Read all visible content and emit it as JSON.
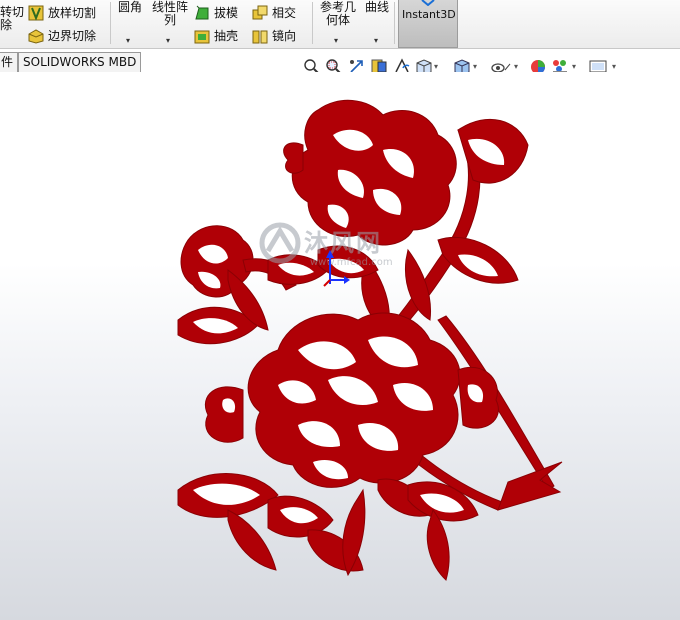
{
  "ribbon": {
    "cmd_revolve_cut_line1": "转切",
    "cmd_revolve_cut_line2": "除",
    "cmd_lofted_cut": "放样切割",
    "cmd_boundary_cut": "边界切除",
    "cmd_fillet": "圆角",
    "cmd_linear_pattern_line1": "线性阵",
    "cmd_linear_pattern_line2": "列",
    "cmd_draft": "拔模",
    "cmd_shell": "抽壳",
    "cmd_intersect": "相交",
    "cmd_mirror": "镜向",
    "cmd_ref_geometry_line1": "参考几",
    "cmd_ref_geometry_line2": "何体",
    "cmd_curves": "曲线",
    "cmd_instant3d": "Instant3D",
    "caret": "▾"
  },
  "tabs": [
    {
      "label": "件"
    },
    {
      "label": "SOLIDWORKS MBD"
    }
  ],
  "hud_icons": [
    "zoom-to-fit-icon",
    "zoom-area-icon",
    "previous-view-icon",
    "section-view-icon",
    "dynamic-annotation-icon",
    "view-orientation-icon",
    "display-style-icon",
    "hide-show-items-icon",
    "edit-appearance-icon",
    "apply-scene-icon",
    "view-settings-icon"
  ],
  "watermark": {
    "text_cn": "沐风网",
    "text_url": "www.mfcad.com"
  },
  "colors": {
    "papercut_red": "#b00006",
    "triad_y": "#1a33ff",
    "triad_x": "#d40000"
  }
}
